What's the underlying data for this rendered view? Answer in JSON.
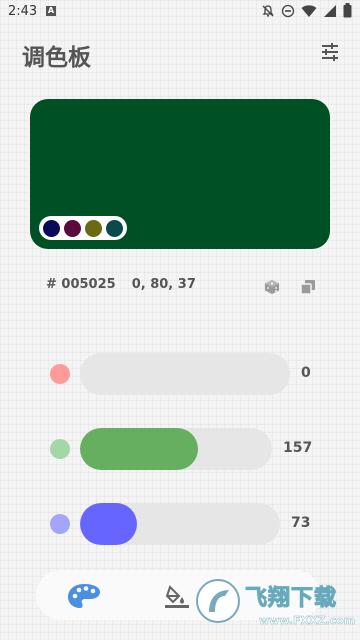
{
  "status_bar": {
    "time": "2:43",
    "icons": [
      "a-notification-icon",
      "bell-off-icon",
      "dnd-icon",
      "wifi-icon",
      "signal-icon",
      "battery-icon"
    ]
  },
  "header": {
    "title": "调色板",
    "settings_icon": "sliders-icon"
  },
  "preview": {
    "color": "#005025",
    "swatches": [
      "#0a0a5a",
      "#5a0a3a",
      "#6a6a14",
      "#0a4a4a"
    ]
  },
  "info": {
    "hex_label": "# 005025",
    "rgb_label": "0, 80, 37",
    "dice_icon": "dice-icon",
    "copy_icon": "copy-icon"
  },
  "sliders": [
    {
      "name": "red",
      "value": "0",
      "fraction": 0.0,
      "dot_color": "#ff9a9a",
      "fill_color": "#ef6b6b"
    },
    {
      "name": "green",
      "value": "157",
      "fraction": 0.616,
      "dot_color": "#a5d6a7",
      "fill_color": "#66ae60"
    },
    {
      "name": "blue",
      "value": "73",
      "fraction": 0.286,
      "dot_color": "#a5a5f5",
      "fill_color": "#6666ff"
    }
  ],
  "bottom_nav": {
    "items": [
      {
        "icon": "palette-icon",
        "active": true,
        "color": "#4a8fe0"
      },
      {
        "icon": "paint-bucket-icon",
        "active": false,
        "color": "#666666"
      }
    ]
  },
  "watermark": {
    "text": "飞翔下载",
    "url": "www.FXXZ.com"
  }
}
